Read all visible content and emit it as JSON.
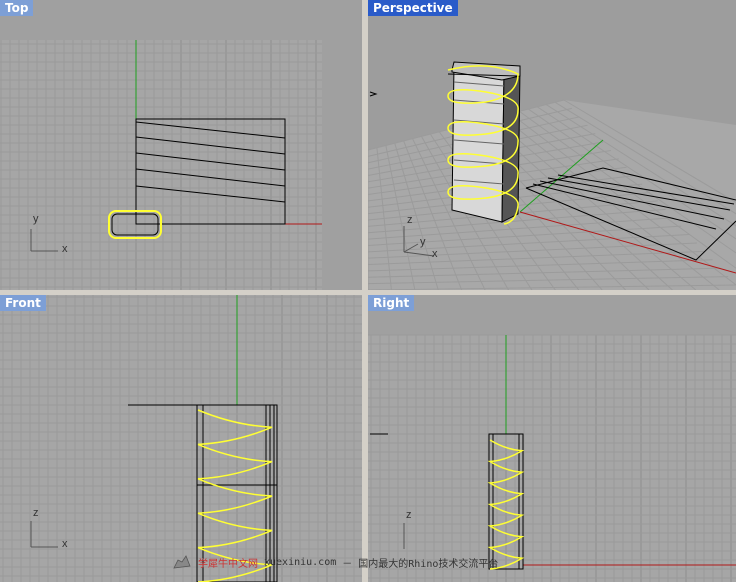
{
  "viewports": {
    "top": {
      "label": "Top",
      "axis_x": "x",
      "axis_y": "y"
    },
    "perspective": {
      "label": "Perspective",
      "axis_x": "x",
      "axis_y": "y",
      "axis_z": "z"
    },
    "front": {
      "label": "Front",
      "axis_x": "x",
      "axis_z": "z"
    },
    "right": {
      "label": "Right",
      "axis_z": "z"
    }
  },
  "watermark": {
    "brand": "学犀牛中文网",
    "url": "xuexiniu.com",
    "slogan": "－ 国内最大的Rhino技术交流平台"
  },
  "colors": {
    "viewport_bg": "#a0a0a0",
    "grid": "#999999",
    "grid_major": "#8a8a8a",
    "axis_x": "#b01818",
    "axis_y": "#1fa01f",
    "curve": "#000000",
    "selection": "#ffff33",
    "title_active": "#2a5bc9",
    "title_inactive": "#7d9fd6"
  },
  "icons": {
    "watermark_logo": "rhino-logo-icon"
  }
}
